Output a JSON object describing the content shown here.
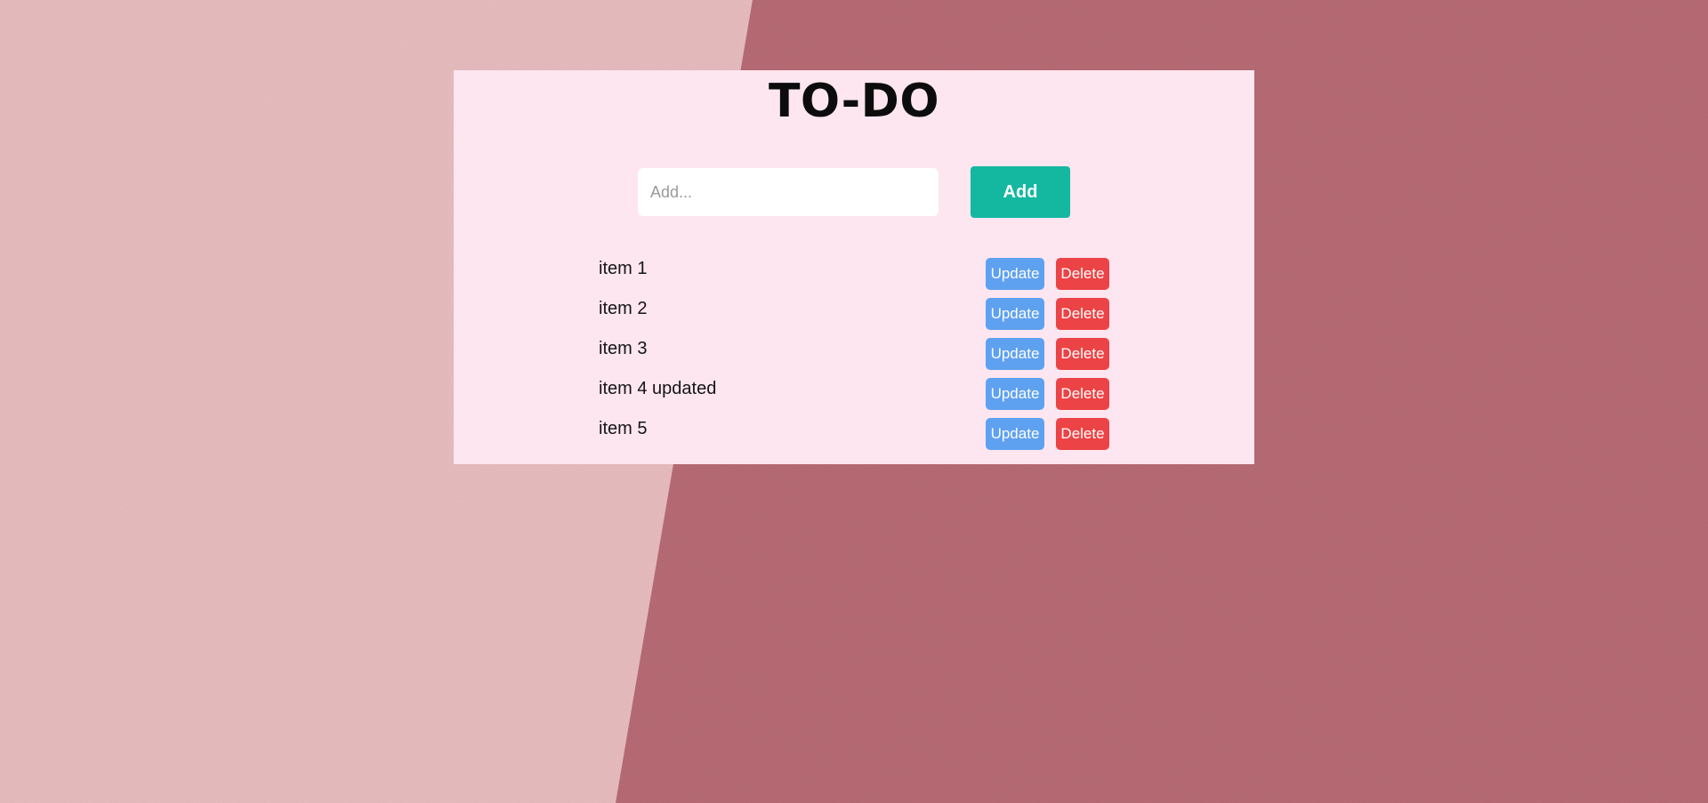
{
  "colors": {
    "card_background": "#fde6f0",
    "add_button": "#14b8a0",
    "update_button": "#5ea1f0",
    "delete_button": "#ec4346",
    "background_light": "#e8bcbf",
    "background_dark": "#b76d78"
  },
  "header": {
    "title": "TO-DO"
  },
  "add_form": {
    "input_value": "",
    "input_placeholder": "Add...",
    "add_label": "Add"
  },
  "todos": [
    {
      "text": "item 1",
      "update_label": "Update",
      "delete_label": "Delete"
    },
    {
      "text": "item 2",
      "update_label": "Update",
      "delete_label": "Delete"
    },
    {
      "text": "item 3",
      "update_label": "Update",
      "delete_label": "Delete"
    },
    {
      "text": "item 4 updated",
      "update_label": "Update",
      "delete_label": "Delete"
    },
    {
      "text": "item 5",
      "update_label": "Update",
      "delete_label": "Delete"
    }
  ]
}
